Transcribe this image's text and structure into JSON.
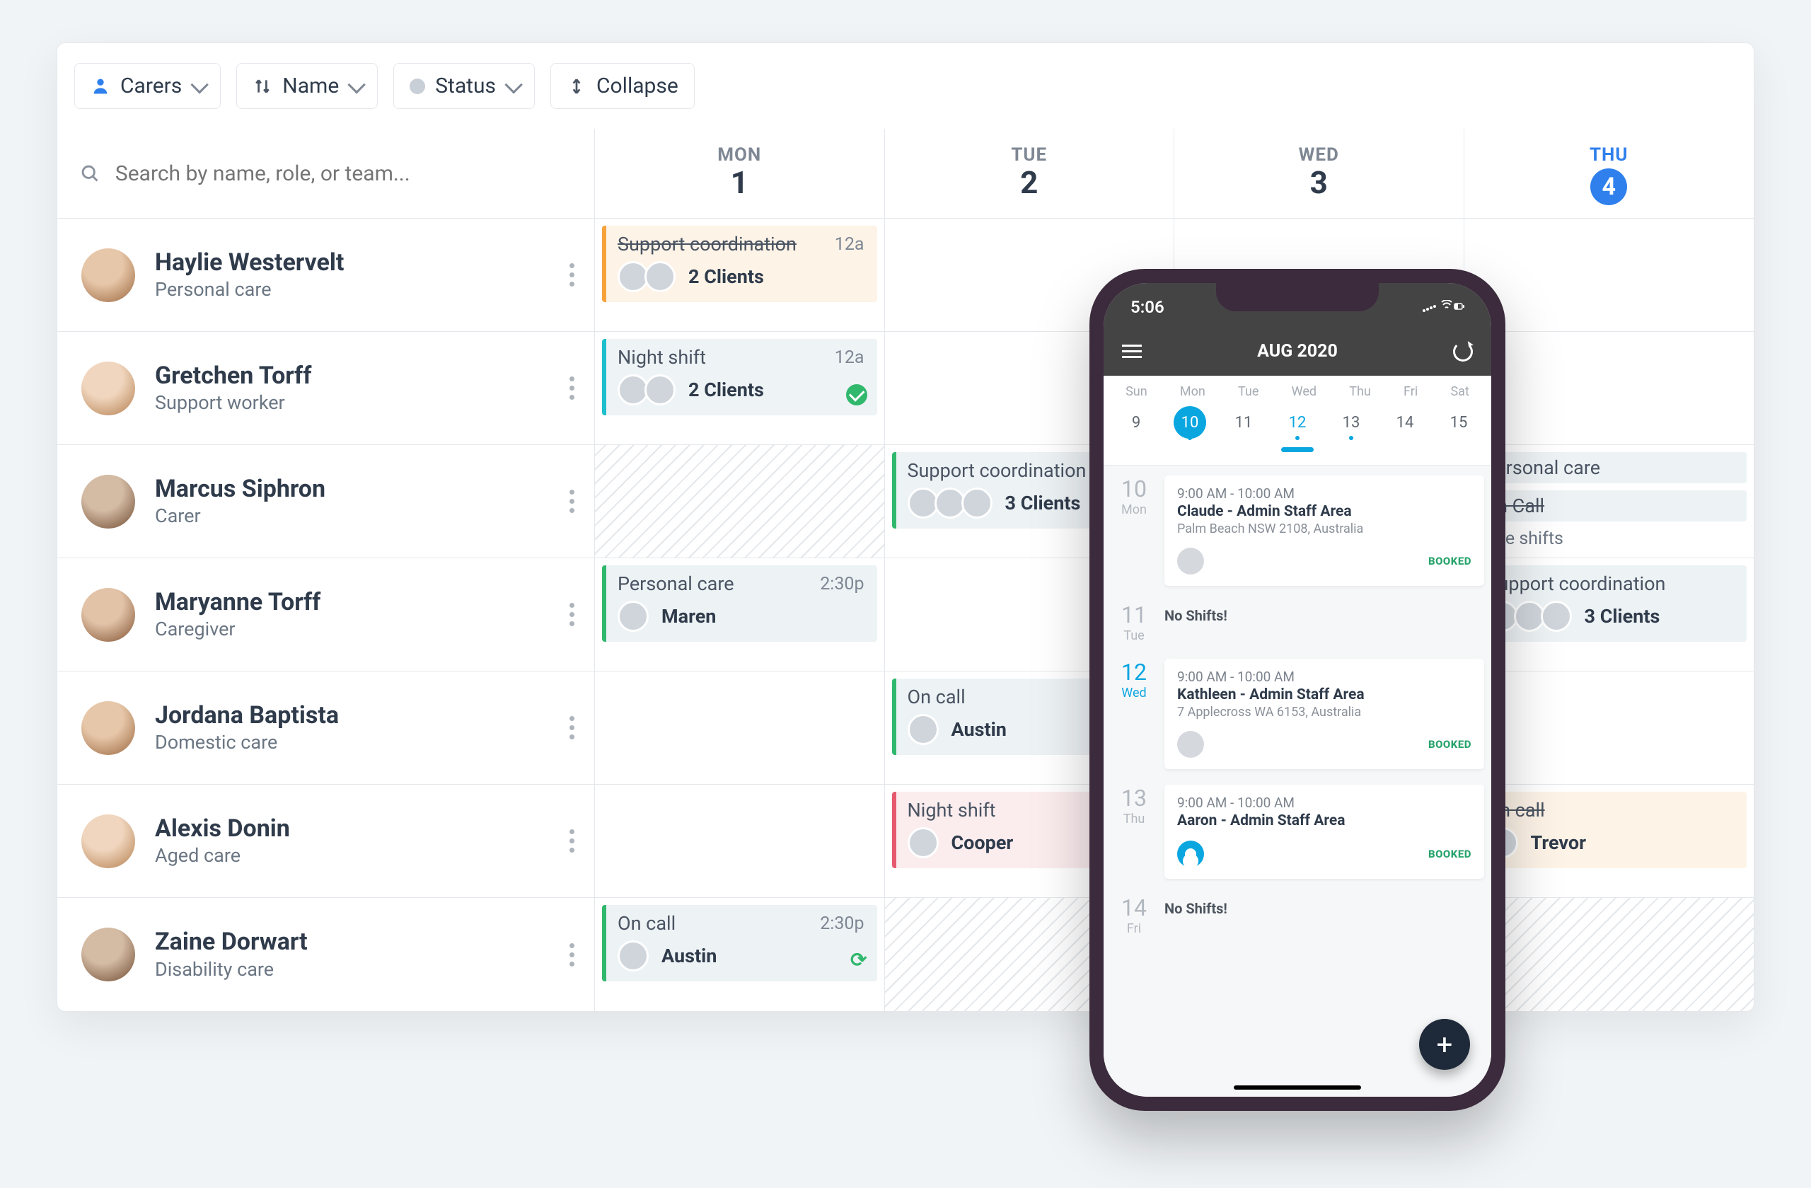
{
  "toolbar": {
    "carers": "Carers",
    "name": "Name",
    "status": "Status",
    "collapse": "Collapse"
  },
  "search": {
    "placeholder": "Search by name, role, or team..."
  },
  "days": [
    {
      "dow": "MON",
      "num": "1",
      "active": false
    },
    {
      "dow": "TUE",
      "num": "2",
      "active": false
    },
    {
      "dow": "WED",
      "num": "3",
      "active": false
    },
    {
      "dow": "THU",
      "num": "4",
      "active": true
    }
  ],
  "rows": [
    {
      "name": "Haylie Westervelt",
      "role": "Personal care",
      "cells": [
        {
          "shifts": [
            {
              "title": "Support coordination",
              "struck": true,
              "time": "12a",
              "clients": "2 Clients",
              "avatars": 2,
              "col": "orange"
            }
          ]
        },
        {},
        {},
        {}
      ]
    },
    {
      "name": "Gretchen Torff",
      "role": "Support worker",
      "cells": [
        {
          "shifts": [
            {
              "title": "Night shift",
              "time": "12a",
              "clients": "2 Clients",
              "avatars": 2,
              "col": "cyan",
              "check": true
            }
          ]
        },
        {},
        {},
        {}
      ]
    },
    {
      "name": "Marcus Siphron",
      "role": "Carer",
      "cells": [
        {
          "hatched": true
        },
        {
          "shifts": [
            {
              "title": "Support coordination",
              "clients": "3 Clients",
              "avatars": 3,
              "col": "green"
            }
          ]
        },
        {},
        {
          "shifts": [
            {
              "title": "Personal care",
              "col": "green",
              "slim": true
            },
            {
              "title": "On Call",
              "struck": true,
              "col": "green",
              "slim": true
            },
            {
              "more": "more shifts",
              "slim": true
            }
          ]
        }
      ]
    },
    {
      "name": "Maryanne Torff",
      "role": "Caregiver",
      "cells": [
        {
          "shifts": [
            {
              "title": "Personal care",
              "time": "2:30p",
              "client": "Maren",
              "avatars": 1,
              "col": "green"
            }
          ]
        },
        {},
        {},
        {
          "shifts": [
            {
              "title": "Support coordination",
              "clients": "3 Clients",
              "avatars": 3,
              "col": "green"
            }
          ]
        }
      ]
    },
    {
      "name": "Jordana Baptista",
      "role": "Domestic care",
      "cells": [
        {},
        {
          "shifts": [
            {
              "title": "On call",
              "client": "Austin",
              "avatars": 1,
              "col": "green"
            }
          ]
        },
        {},
        {}
      ]
    },
    {
      "name": "Alexis Donin",
      "role": "Aged care",
      "cells": [
        {},
        {
          "shifts": [
            {
              "title": "Night shift",
              "client": "Cooper",
              "avatars": 1,
              "col": "red"
            }
          ]
        },
        {},
        {
          "shifts": [
            {
              "title": "On call",
              "struck": true,
              "client": "Trevor",
              "avatars": 1,
              "col": "orange"
            }
          ]
        }
      ]
    },
    {
      "name": "Zaine Dorwart",
      "role": "Disability care",
      "cells": [
        {
          "shifts": [
            {
              "title": "On call",
              "time": "2:30p",
              "client": "Austin",
              "avatars": 1,
              "col": "green",
              "cycle": true
            }
          ]
        },
        {
          "hatched": true
        },
        {
          "hatched": true
        },
        {
          "hatched": true
        }
      ]
    }
  ],
  "phone": {
    "time": "5:06",
    "title": "AUG 2020",
    "weekDays": [
      "Sun",
      "Mon",
      "Tue",
      "Wed",
      "Thu",
      "Fri",
      "Sat"
    ],
    "weekNums": [
      "9",
      "10",
      "11",
      "12",
      "13",
      "14",
      "15"
    ],
    "activeIdx": 1,
    "wedIdx": 3,
    "sections": [
      {
        "dnum": "10",
        "dnam": "Mon",
        "card": {
          "tm": "9:00 AM - 10:00 AM",
          "ttl": "Claude  - Admin Staff Area",
          "addr": "Palm Beach NSW 2108, Australia",
          "booked": "BOOKED"
        }
      },
      {
        "dnum": "11",
        "dnam": "Tue",
        "empty": "No Shifts!"
      },
      {
        "dnum": "12",
        "dnam": "Wed",
        "wed": true,
        "card": {
          "tm": "9:00 AM - 10:00 AM",
          "ttl": "Kathleen - Admin Staff Area",
          "addr": "7 Applecross WA 6153, Australia",
          "booked": "BOOKED"
        }
      },
      {
        "dnum": "13",
        "dnam": "Thu",
        "card": {
          "tm": "9:00 AM - 10:00 AM",
          "ttl": "Aaron - Admin Staff Area",
          "booked": "BOOKED",
          "icon": true
        }
      },
      {
        "dnum": "14",
        "dnam": "Fri",
        "empty": "No Shifts!"
      }
    ],
    "fab": "+"
  }
}
